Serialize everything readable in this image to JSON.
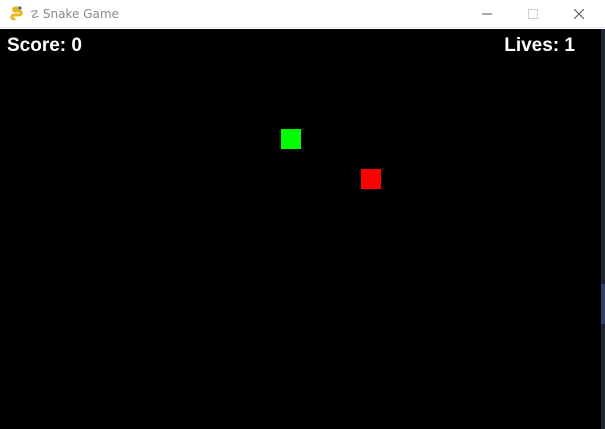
{
  "window": {
    "title": "Snake Game",
    "app_icon": "pygame-snake-icon",
    "controls": {
      "minimize_icon": "minimize-icon",
      "maximize_icon": "maximize-icon",
      "close_icon": "close-icon"
    }
  },
  "hud": {
    "score_label": "Score: 0",
    "lives_label": "Lives: 1"
  },
  "game": {
    "background_color": "#000000",
    "snake_color": "#00ff00",
    "food_color": "#ff0000"
  }
}
